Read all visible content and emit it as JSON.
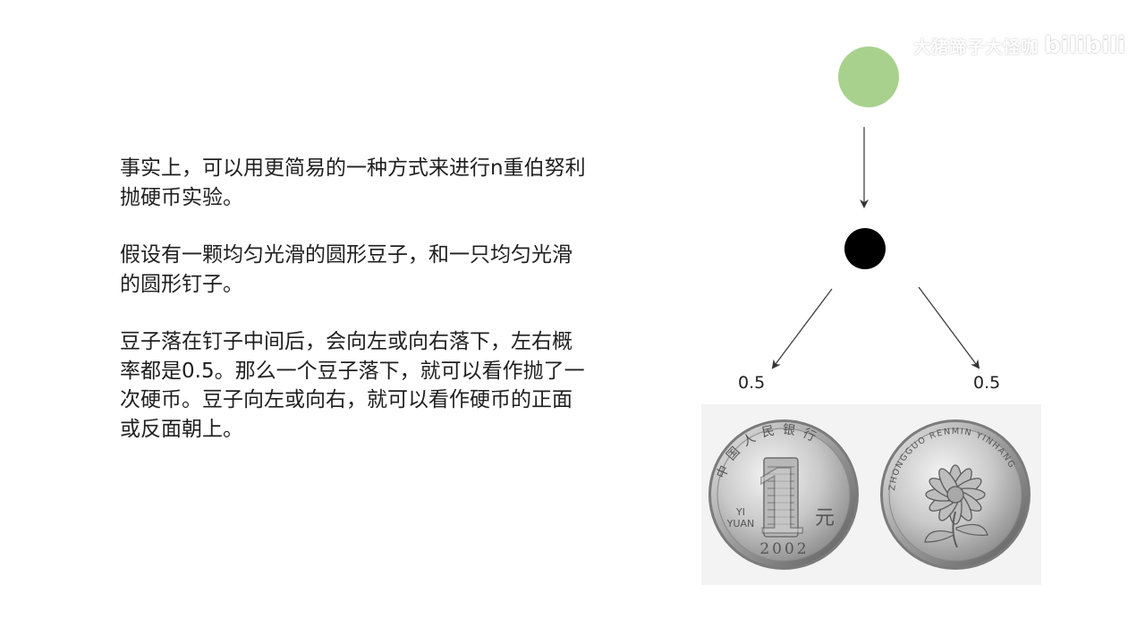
{
  "watermark": {
    "uploader": "大猪蹄子大怪咖",
    "logo": "bilibili"
  },
  "paragraphs": [
    "事实上，可以用更简易的一种方式来进行n重伯努利\n抛硬币实验。",
    "假设有一颗均匀光滑的圆形豆子，和一只均匀光滑\n的圆形钉子。",
    "豆子落在钉子中间后，会向左或向右落下，左右概\n率都是0.5。那么一个豆子落下，就可以看作抛了一\n次硬币。豆子向左或向右，就可以看作硬币的正面\n或反面朝上。"
  ],
  "diagram": {
    "bean_color": "#a9d18e",
    "peg_color": "#000000",
    "left_probability": "0.5",
    "right_probability": "0.5"
  },
  "coins": {
    "obverse": {
      "top_text": "中国人民银行",
      "denomination": "1",
      "yi": "YI",
      "yuan": "YUAN",
      "yuan_cn": "元",
      "year": "2002"
    },
    "reverse": {
      "ring_text": "ZHONGGUO RENMIN YINHANG"
    }
  }
}
